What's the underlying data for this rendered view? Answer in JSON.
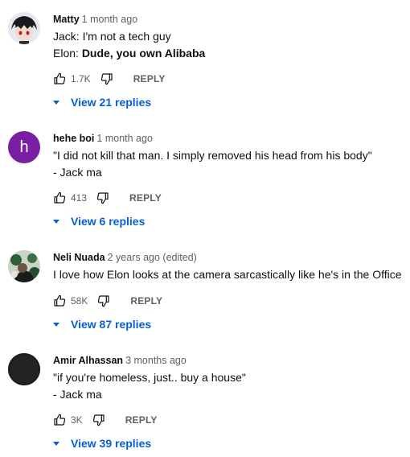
{
  "comments": [
    {
      "author": "Matty",
      "time": "1 month ago",
      "lines": [
        {
          "prefix": "Jack: ",
          "bold": "",
          "rest": "I'm not a tech guy"
        },
        {
          "prefix": "Elon: ",
          "bold": "Dude, you own Alibaba",
          "rest": ""
        }
      ],
      "likes": "1.7K",
      "reply_label": "REPLY",
      "replies_label": "View 21 replies",
      "avatar": "anime-avatar"
    },
    {
      "author": "hehe boi",
      "time": "1 month ago",
      "lines": [
        {
          "prefix": "\"I did not kill that man. I simply removed his head from his body\"",
          "bold": "",
          "rest": ""
        },
        {
          "prefix": "- Jack ma",
          "bold": "",
          "rest": ""
        }
      ],
      "likes": "413",
      "reply_label": "REPLY",
      "replies_label": "View 6 replies",
      "avatar": "letter-avatar",
      "avatar_letter": "h",
      "avatar_color": "#7b1fa2"
    },
    {
      "author": "Neli Nuada",
      "time": "2 years ago (edited)",
      "lines": [
        {
          "prefix": "I love how Elon looks at the camera sarcastically like he's in the Office",
          "bold": "",
          "rest": ""
        }
      ],
      "likes": "58K",
      "reply_label": "REPLY",
      "replies_label": "View 87 replies",
      "avatar": "photo-avatar"
    },
    {
      "author": "Amir Alhassan",
      "time": "3 months ago",
      "lines": [
        {
          "prefix": "\"if you're homeless, just.. buy a house\"",
          "bold": "",
          "rest": ""
        },
        {
          "prefix": "- Jack ma",
          "bold": "",
          "rest": ""
        }
      ],
      "likes": "3K",
      "reply_label": "REPLY",
      "replies_label": "View 39 replies",
      "avatar": "dark-avatar"
    }
  ],
  "colors": {
    "link": "#065fd4",
    "secondary": "#606060"
  }
}
